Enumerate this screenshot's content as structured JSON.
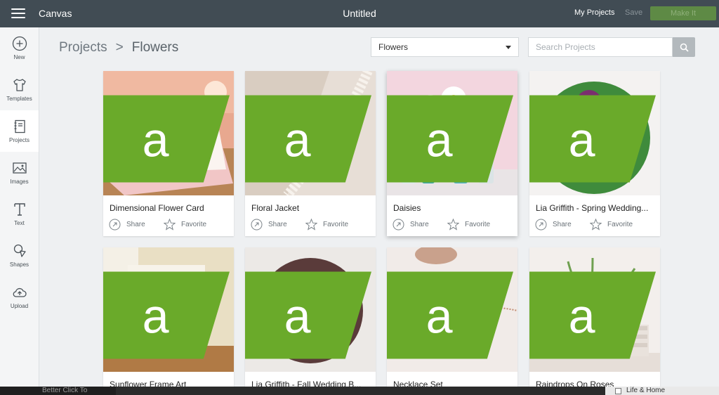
{
  "app": {
    "name": "Canvas",
    "document_title": "Untitled"
  },
  "header": {
    "my_projects": "My Projects",
    "save": "Save",
    "make_it": "Make It"
  },
  "sidebar": {
    "items": [
      {
        "label": "New",
        "icon": "plus-circle-icon"
      },
      {
        "label": "Templates",
        "icon": "tshirt-icon"
      },
      {
        "label": "Projects",
        "icon": "notebook-icon"
      },
      {
        "label": "Images",
        "icon": "image-icon"
      },
      {
        "label": "Text",
        "icon": "text-t-icon"
      },
      {
        "label": "Shapes",
        "icon": "shapes-icon"
      },
      {
        "label": "Upload",
        "icon": "cloud-upload-icon"
      }
    ]
  },
  "breadcrumb": {
    "root": "Projects",
    "separator": ">",
    "current": "Flowers"
  },
  "filter": {
    "selected": "Flowers"
  },
  "search": {
    "placeholder": "Search Projects"
  },
  "card_actions": {
    "share": "Share",
    "favorite": "Favorite"
  },
  "projects": [
    {
      "title": "Dimensional Flower Card"
    },
    {
      "title": "Floral Jacket"
    },
    {
      "title": "Daisies"
    },
    {
      "title": "Lia Griffith - Spring Wedding..."
    },
    {
      "title": "Sunflower Frame Art"
    },
    {
      "title": "Lia Griffith - Fall Wedding B..."
    },
    {
      "title": "Necklace Set"
    },
    {
      "title": "Raindrops On Roses"
    }
  ],
  "taskbar": {
    "left_text": "Better Click To",
    "right_text": "Life & Home"
  },
  "colors": {
    "topbar": "#414c54",
    "make_it": "#5e8a45",
    "badge": "#6aaa2a",
    "background": "#eef0f2"
  }
}
